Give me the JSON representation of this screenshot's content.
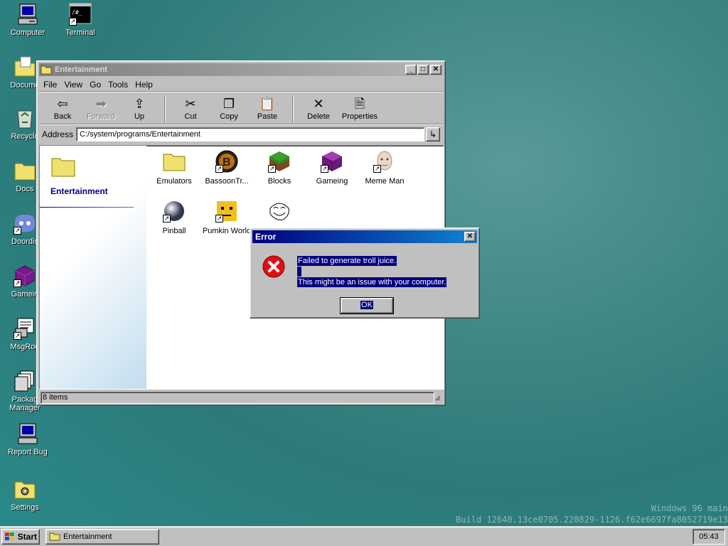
{
  "desktop": {
    "icons": [
      {
        "label": "Computer",
        "icon": "computer-icon"
      },
      {
        "label": "Terminal",
        "icon": "terminal-icon"
      },
      {
        "label": "Docume",
        "icon": "documents-folder-icon"
      },
      {
        "label": "Recycle",
        "icon": "recycle-bin-icon"
      },
      {
        "label": "Docs",
        "icon": "folder-icon"
      },
      {
        "label": "Doordis",
        "icon": "discord-icon"
      },
      {
        "label": "Gamein",
        "icon": "cube-icon"
      },
      {
        "label": "MsgRoo",
        "icon": "message-room-icon"
      },
      {
        "label": "Packag Manager",
        "icon": "package-manager-icon"
      },
      {
        "label": "Report Bug",
        "icon": "report-bug-icon"
      },
      {
        "label": "Settings",
        "icon": "settings-icon"
      }
    ],
    "watermark": {
      "line1": "Windows 96 main",
      "line2": "Build 12640.13ce0705.220829-1126.f62e6697fa8052719e13"
    }
  },
  "explorer": {
    "title": "Entertainment",
    "menu": [
      "File",
      "View",
      "Go",
      "Tools",
      "Help"
    ],
    "toolbar": {
      "back": "Back",
      "forward": "Forward",
      "up": "Up",
      "cut": "Cut",
      "copy": "Copy",
      "paste": "Paste",
      "delete": "Delete",
      "properties": "Properties"
    },
    "address_label": "Address",
    "address_value": "C:/system/programs/Entertainment",
    "side_title": "Entertainment",
    "files": [
      {
        "label": "Emulators",
        "icon": "folder-icon"
      },
      {
        "label": "BassoonTr...",
        "icon": "bassoon-tracker-icon"
      },
      {
        "label": "Blocks",
        "icon": "grass-block-icon"
      },
      {
        "label": "Gameing",
        "icon": "purple-cube-icon"
      },
      {
        "label": "Meme Man",
        "icon": "meme-man-icon"
      },
      {
        "label": "Pinball",
        "icon": "pinball-icon"
      },
      {
        "label": "Pumkin World",
        "icon": "pumkin-world-icon"
      },
      {
        "label": "",
        "icon": "trollface-icon"
      }
    ],
    "status": "8 items"
  },
  "dialog": {
    "title": "Error",
    "line1": "Failed to generate troll juice.",
    "line2": "This might be an issue with your computer.",
    "ok": "OK"
  },
  "taskbar": {
    "start": "Start",
    "task": "Entertainment",
    "clock": "05:43"
  },
  "colors": {
    "desktop": "#2d7a78",
    "face": "#c0c0c0",
    "title_active": "#000080",
    "title_inactive": "#808080",
    "error_red": "#e01010"
  }
}
